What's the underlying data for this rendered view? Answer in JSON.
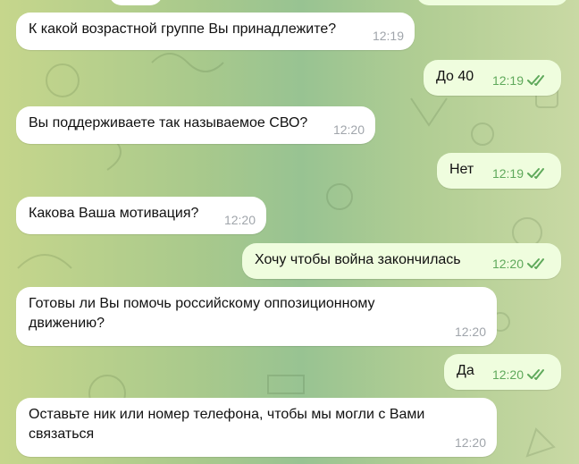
{
  "colors": {
    "incoming_bubble": "#ffffff",
    "outgoing_bubble": "#effdde",
    "outgoing_time": "#5fa95b",
    "incoming_time": "#a0a5ab",
    "read_checkmark": "#5fa95b"
  },
  "messages": [
    {
      "direction": "in",
      "text": "К какой возрастной группе Вы принадлежите?",
      "time": "12:19"
    },
    {
      "direction": "out",
      "text": "До 40",
      "time": "12:19",
      "status_icon": "double-check-icon"
    },
    {
      "direction": "in",
      "text": "Вы поддерживаете так называемое СВО?",
      "time": "12:20"
    },
    {
      "direction": "out",
      "text": "Нет",
      "time": "12:19",
      "status_icon": "double-check-icon"
    },
    {
      "direction": "in",
      "text": "Какова Ваша мотивация?",
      "time": "12:20"
    },
    {
      "direction": "out",
      "text": "Хочу чтобы война закончилась",
      "time": "12:20",
      "status_icon": "double-check-icon"
    },
    {
      "direction": "in",
      "text": "Готовы ли Вы помочь российскому оппозиционному движению?",
      "time": "12:20"
    },
    {
      "direction": "out",
      "text": "Да",
      "time": "12:20",
      "status_icon": "double-check-icon"
    },
    {
      "direction": "in",
      "text": "Оставьте ник или номер телефона, чтобы мы могли с Вами связаться",
      "time": "12:20"
    }
  ]
}
